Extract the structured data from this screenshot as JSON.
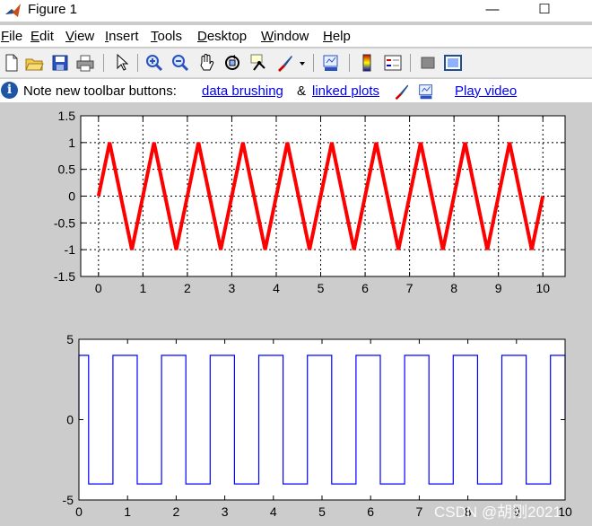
{
  "window": {
    "title": "Figure 1",
    "minimize_glyph": "—",
    "maximize_glyph": "☐"
  },
  "menu": [
    {
      "label": "File",
      "mnemonic": "F",
      "rest": "ile"
    },
    {
      "label": "Edit",
      "mnemonic": "E",
      "rest": "dit"
    },
    {
      "label": "View",
      "mnemonic": "V",
      "rest": "iew"
    },
    {
      "label": "Insert",
      "mnemonic": "I",
      "rest": "nsert"
    },
    {
      "label": "Tools",
      "mnemonic": "T",
      "rest": "ools"
    },
    {
      "label": "Desktop",
      "mnemonic": "D",
      "rest": "esktop"
    },
    {
      "label": "Window",
      "mnemonic": "W",
      "rest": "indow"
    },
    {
      "label": "Help",
      "mnemonic": "H",
      "rest": "elp"
    }
  ],
  "toolbar": {
    "icons": [
      "new-file-icon",
      "open-folder-icon",
      "save-icon",
      "print-icon",
      "pointer-icon",
      "zoom-in-icon",
      "zoom-out-icon",
      "pan-hand-icon",
      "rotate-3d-icon",
      "data-cursor-icon",
      "brush-icon",
      "brush-dropdown-icon",
      "link-plot-icon",
      "colorbar-icon",
      "legend-icon",
      "hide-plot-tools-icon",
      "show-plot-tools-icon"
    ]
  },
  "note": {
    "prefix": "Note new toolbar buttons:",
    "link1": "data brushing",
    "amp": "&",
    "link2": "linked plots",
    "video": "Play video"
  },
  "watermark": "CSDN @胡刚2021",
  "colors": {
    "triangle": "#ff0000",
    "square": "#0000ff",
    "background": "#cccccc"
  },
  "chart_data": [
    {
      "type": "line",
      "title": "",
      "xlabel": "",
      "ylabel": "",
      "xlim": [
        -0.4,
        10.5
      ],
      "ylim": [
        -1.5,
        1.5
      ],
      "xticks": [
        "0",
        "1",
        "2",
        "3",
        "4",
        "5",
        "6",
        "7",
        "8",
        "9",
        "10"
      ],
      "yticks": [
        "-1.5",
        "-1",
        "-0.5",
        "0",
        "0.5",
        "1",
        "1.5"
      ],
      "grid": true,
      "series": [
        {
          "x": [
            0,
            0.25,
            0.75,
            1.25,
            1.75,
            2.25,
            2.75,
            3.25,
            3.75,
            4.25,
            4.75,
            5.25,
            5.75,
            6.25,
            6.75,
            7.25,
            7.75,
            8.25,
            8.75,
            9.25,
            9.75,
            10
          ],
          "values": [
            0,
            1,
            -1,
            1,
            -1,
            1,
            -1,
            1,
            -1,
            1,
            -1,
            1,
            -1,
            1,
            -1,
            1,
            -1,
            1,
            -1,
            1,
            -1,
            0
          ]
        }
      ]
    },
    {
      "type": "line",
      "title": "",
      "xlabel": "",
      "ylabel": "",
      "xlim": [
        0,
        10
      ],
      "ylim": [
        -5,
        5
      ],
      "xticks": [
        "0",
        "1",
        "2",
        "3",
        "4",
        "5",
        "6",
        "7",
        "8",
        "9",
        "10"
      ],
      "yticks": [
        "-5",
        "0",
        "5"
      ],
      "grid": false,
      "series": [
        {
          "x": [
            0,
            0,
            0.2,
            0.2,
            0.7,
            0.7,
            1.2,
            1.2,
            1.7,
            1.7,
            2.2,
            2.2,
            2.7,
            2.7,
            3.2,
            3.2,
            3.7,
            3.7,
            4.2,
            4.2,
            4.7,
            4.7,
            5.2,
            5.2,
            5.7,
            5.7,
            6.2,
            6.2,
            6.7,
            6.7,
            7.2,
            7.2,
            7.7,
            7.7,
            8.2,
            8.2,
            8.7,
            8.7,
            9.2,
            9.2,
            9.7,
            9.7,
            10,
            10
          ],
          "values": [
            0,
            4,
            4,
            -4,
            -4,
            4,
            4,
            -4,
            -4,
            4,
            4,
            -4,
            -4,
            4,
            4,
            -4,
            -4,
            4,
            4,
            -4,
            -4,
            4,
            4,
            -4,
            -4,
            4,
            4,
            -4,
            -4,
            4,
            4,
            -4,
            -4,
            4,
            4,
            -4,
            -4,
            4,
            4,
            -4,
            -4,
            4,
            4,
            0
          ]
        }
      ]
    }
  ]
}
